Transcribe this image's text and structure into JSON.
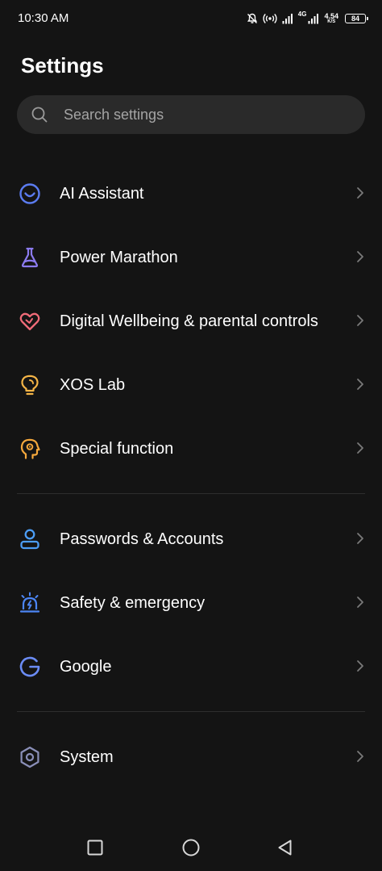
{
  "status_bar": {
    "time": "10:30 AM",
    "network_type": "4G",
    "net_speed_value": "4.54",
    "net_speed_unit": "K/S",
    "battery_level": "84"
  },
  "header": {
    "title": "Settings"
  },
  "search": {
    "placeholder": "Search settings"
  },
  "groups": [
    {
      "items": [
        {
          "label": "AI Assistant",
          "icon": "ai-assistant-icon",
          "color": "#5b7cf0"
        },
        {
          "label": "Power Marathon",
          "icon": "flask-icon",
          "color": "#8c7bf0"
        },
        {
          "label": "Digital Wellbeing & parental controls",
          "icon": "heart-icon",
          "color": "#f06b78"
        },
        {
          "label": "XOS Lab",
          "icon": "lightbulb-icon",
          "color": "#f5b547"
        },
        {
          "label": "Special function",
          "icon": "head-gear-icon",
          "color": "#f5a83c"
        }
      ]
    },
    {
      "items": [
        {
          "label": "Passwords & Accounts",
          "icon": "user-icon",
          "color": "#4c9df5"
        },
        {
          "label": "Safety & emergency",
          "icon": "siren-icon",
          "color": "#4c86f5"
        },
        {
          "label": "Google",
          "icon": "google-icon",
          "color": "#6b8cf5"
        }
      ]
    },
    {
      "items": [
        {
          "label": "System",
          "icon": "hexagon-gear-icon",
          "color": "#8a8fb8"
        }
      ]
    }
  ],
  "nav": {
    "buttons": [
      "recents",
      "home",
      "back"
    ]
  }
}
